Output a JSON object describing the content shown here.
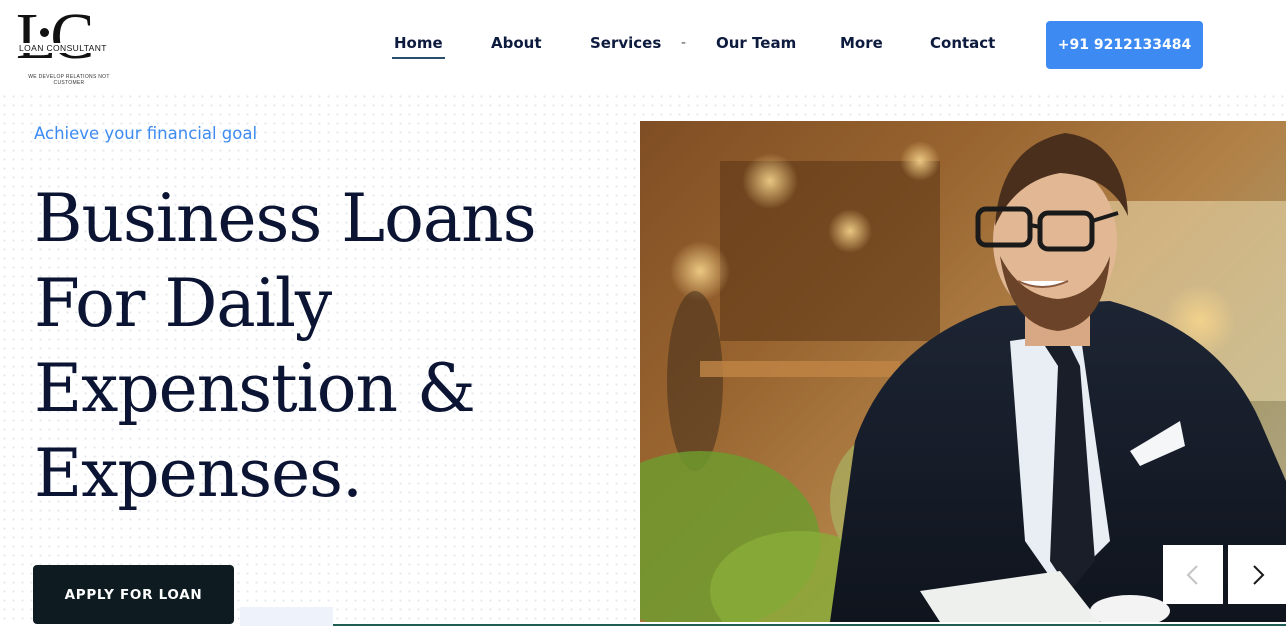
{
  "logo": {
    "letters": "LC",
    "name": "LOAN CONSULTANT",
    "tagline": "WE DEVELOP RELATIONS NOT CUSTOMER"
  },
  "nav": {
    "items": [
      {
        "label": "Home",
        "active": true
      },
      {
        "label": "About",
        "active": false
      },
      {
        "label": "Services",
        "active": false
      },
      {
        "label": "Our Team",
        "active": false
      },
      {
        "label": "More",
        "active": false
      },
      {
        "label": "Contact",
        "active": false
      }
    ],
    "separator": "-",
    "phone": "+91 9212133484"
  },
  "hero": {
    "subtitle": "Achieve your financial goal",
    "headline_lines": [
      "Business Loans",
      "For Daily",
      "Expenstion &",
      "Expenses."
    ],
    "cta_label": "APPLY FOR LOAN",
    "image_description_icon": "hero-photo-businessman"
  },
  "slider": {
    "prev_icon": "chevron-left-icon",
    "next_icon": "chevron-right-icon"
  },
  "colors": {
    "accent": "#3d8bf2",
    "heading": "#0b1433",
    "button_dark": "#0e1c22"
  }
}
